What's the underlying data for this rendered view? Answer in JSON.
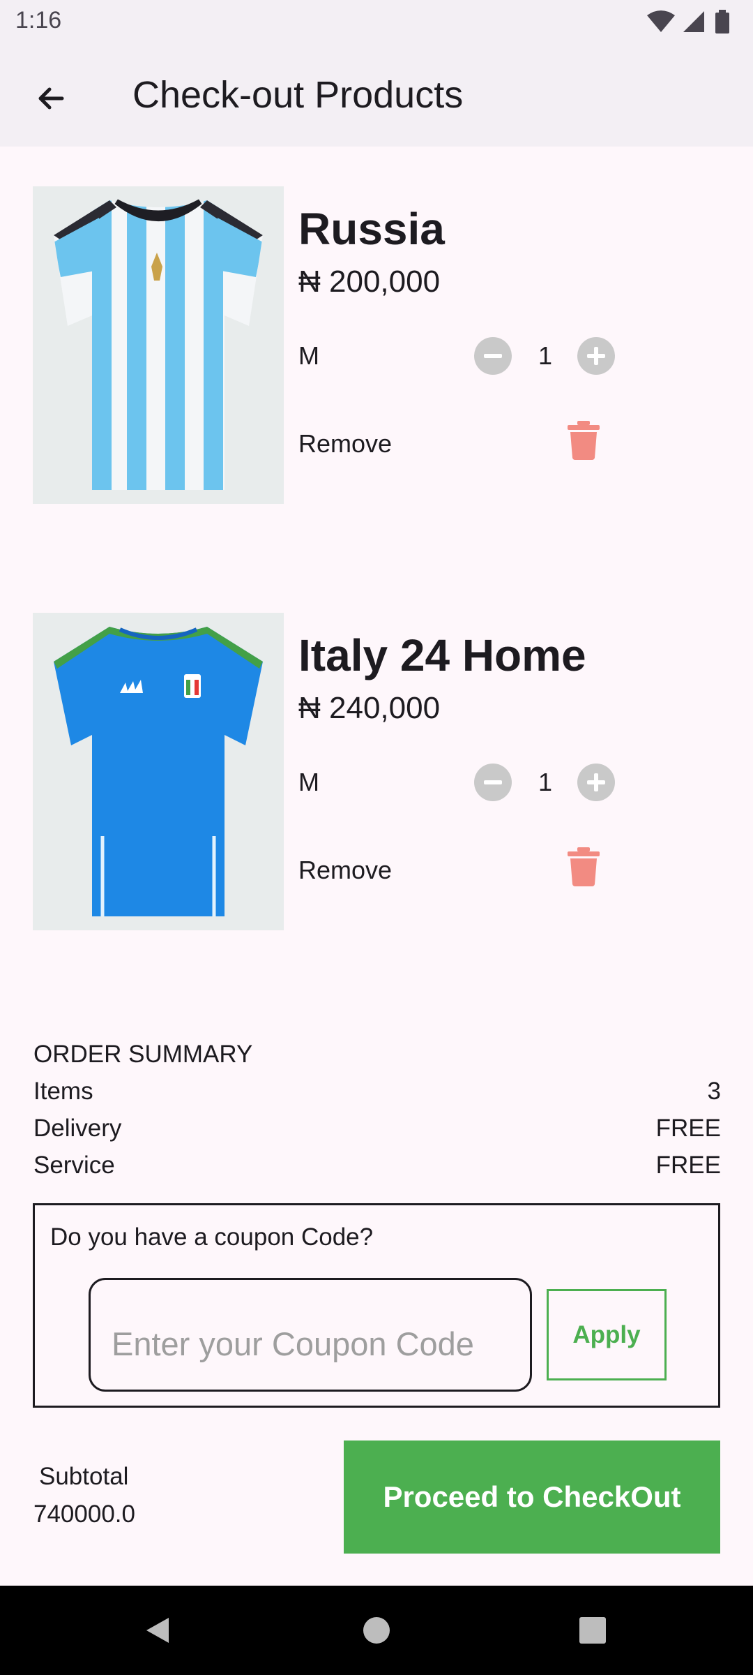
{
  "status_bar": {
    "time": "1:16"
  },
  "app_bar": {
    "title": "Check-out Products"
  },
  "products": [
    {
      "name": "Russia",
      "price": "₦ 200,000",
      "size": "M",
      "quantity": "1",
      "remove_label": "Remove"
    },
    {
      "name": "Italy 24 Home",
      "price": "₦ 240,000",
      "size": "M",
      "quantity": "1",
      "remove_label": "Remove"
    }
  ],
  "summary": {
    "heading": "ORDER SUMMARY",
    "rows": [
      {
        "label": "Items",
        "value": "3"
      },
      {
        "label": "Delivery",
        "value": "FREE"
      },
      {
        "label": "Service",
        "value": "FREE"
      }
    ]
  },
  "coupon": {
    "question": "Do you have a coupon Code?",
    "placeholder": "Enter your Coupon Code",
    "value": "",
    "apply_label": "Apply"
  },
  "footer": {
    "subtotal_label": "Subtotal",
    "subtotal_value": "740000.0",
    "checkout_label": "Proceed to CheckOut"
  },
  "colors": {
    "accent": "#4caf50",
    "trash": "#f28b82",
    "app_bar": "#f3eff4",
    "background": "#fef7fb"
  },
  "icons": {
    "back": "arrow-left-icon",
    "trash": "trash-icon",
    "minus": "minus-circle-icon",
    "plus": "plus-circle-icon"
  }
}
